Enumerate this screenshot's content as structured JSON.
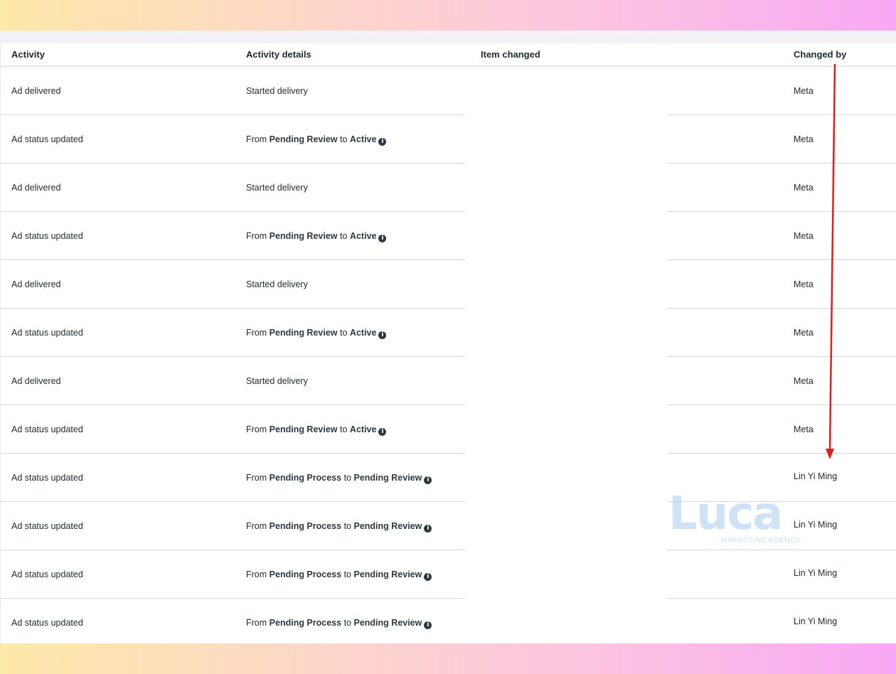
{
  "table": {
    "headers": {
      "activity": "Activity",
      "activity_details": "Activity details",
      "item_changed": "Item changed",
      "changed_by": "Changed by"
    },
    "rows": [
      {
        "activity": "Ad delivered",
        "details_plain": "Started delivery",
        "changed_by": "Meta"
      },
      {
        "activity": "Ad status updated",
        "from_word": "From",
        "from_status": "Pending Review",
        "to_word": "to",
        "to_status": "Active",
        "changed_by": "Meta"
      },
      {
        "activity": "Ad delivered",
        "details_plain": "Started delivery",
        "changed_by": "Meta"
      },
      {
        "activity": "Ad status updated",
        "from_word": "From",
        "from_status": "Pending Review",
        "to_word": "to",
        "to_status": "Active",
        "changed_by": "Meta"
      },
      {
        "activity": "Ad delivered",
        "details_plain": "Started delivery",
        "changed_by": "Meta"
      },
      {
        "activity": "Ad status updated",
        "from_word": "From",
        "from_status": "Pending Review",
        "to_word": "to",
        "to_status": "Active",
        "changed_by": "Meta"
      },
      {
        "activity": "Ad delivered",
        "details_plain": "Started delivery",
        "changed_by": "Meta"
      },
      {
        "activity": "Ad status updated",
        "from_word": "From",
        "from_status": "Pending Review",
        "to_word": "to",
        "to_status": "Active",
        "changed_by": "Meta"
      },
      {
        "activity": "Ad status updated",
        "from_word": "From",
        "from_status": "Pending Process",
        "to_word": "to",
        "to_status": "Pending Review",
        "changed_by": "Lin Yi Ming"
      },
      {
        "activity": "Ad status updated",
        "from_word": "From",
        "from_status": "Pending Process",
        "to_word": "to",
        "to_status": "Pending Review",
        "changed_by": "Lin Yi Ming"
      },
      {
        "activity": "Ad status updated",
        "from_word": "From",
        "from_status": "Pending Process",
        "to_word": "to",
        "to_status": "Pending Review",
        "changed_by": "Lin Yi Ming"
      },
      {
        "activity": "Ad status updated",
        "from_word": "From",
        "from_status": "Pending Process",
        "to_word": "to",
        "to_status": "Pending Review",
        "changed_by": "Lin Yi Ming"
      }
    ]
  },
  "watermark": {
    "word": "Luca",
    "subtitle": "MARKETING AGENCY"
  },
  "icons": {
    "info": "info-icon",
    "annotation": "red-arrow-icon"
  },
  "colors": {
    "annotation_arrow": "#e01e1e",
    "text": "#1c2b33",
    "divider": "#d3d6db"
  }
}
